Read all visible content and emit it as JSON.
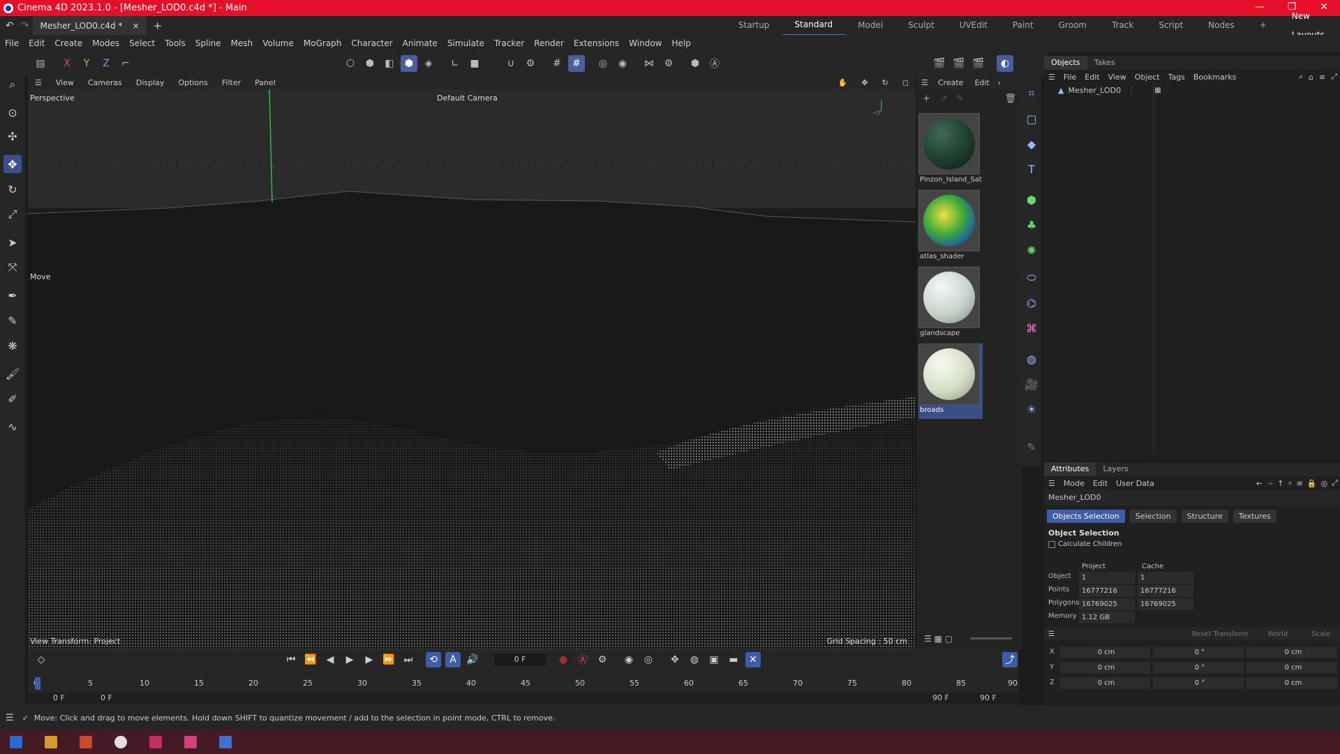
{
  "window": {
    "title": "Cinema 4D 2023.1.0 - [Mesher_LOD0.c4d *] - Main"
  },
  "doc_tab": {
    "label": "Mesher_LOD0.c4d *"
  },
  "layouts": [
    "Startup",
    "Standard",
    "Model",
    "Sculpt",
    "UVEdit",
    "Paint",
    "Groom",
    "Track",
    "Script",
    "Nodes"
  ],
  "layouts_active": "Standard",
  "new_layouts": "New Layouts",
  "menu": [
    "File",
    "Edit",
    "Create",
    "Modes",
    "Select",
    "Tools",
    "Spline",
    "Mesh",
    "Volume",
    "MoGraph",
    "Character",
    "Animate",
    "Simulate",
    "Tracker",
    "Render",
    "Extensions",
    "Window",
    "Help"
  ],
  "coord_buttons": {
    "x": "X",
    "y": "Y",
    "z": "Z"
  },
  "viewport": {
    "menu": [
      "View",
      "Cameras",
      "Display",
      "Options",
      "Filter",
      "Panel"
    ],
    "projection": "Perspective",
    "camera": "Default Camera",
    "move_hint": "Move",
    "view_transform": "View Transform: Project",
    "grid_spacing": "Grid Spacing : 50 cm"
  },
  "materials_panel": {
    "menu": [
      "Create",
      "Edit"
    ],
    "items": [
      {
        "name": "Pinzon_Island_Sat",
        "color": "#1f3d2c"
      },
      {
        "name": "atlas_shader",
        "color": "#3aa83a"
      },
      {
        "name": "glandscape",
        "color": "#c8d2cc"
      },
      {
        "name": "broads",
        "color": "#d6dcc6"
      }
    ]
  },
  "objects_panel": {
    "tabs": [
      "Objects",
      "Takes"
    ],
    "menu": [
      "File",
      "Edit",
      "View",
      "Object",
      "Tags",
      "Bookmarks"
    ],
    "items": [
      {
        "name": "Mesher_LOD0"
      }
    ]
  },
  "attributes_panel": {
    "tabs": [
      "Attributes",
      "Layers"
    ],
    "menu": [
      "Mode",
      "Edit",
      "User Data"
    ],
    "object_name": "Mesher_LOD0",
    "subtabs": [
      "Objects Selection",
      "Selection",
      "Structure",
      "Textures"
    ],
    "section": "Object Selection",
    "calculate_children": "Calculate Children",
    "calculate_children_checked": false,
    "columns": [
      "Project",
      "Cache"
    ],
    "rows": [
      {
        "label": "Object",
        "project": "1",
        "cache": "1"
      },
      {
        "label": "Points",
        "project": "16777216",
        "cache": "16777216"
      },
      {
        "label": "Polygons",
        "project": "16769025",
        "cache": "16769025"
      },
      {
        "label": "Memory",
        "project": "1.12 GB",
        "cache": ""
      }
    ],
    "transform": {
      "reset": "Reset Transform",
      "space": "World",
      "mode": "Scale",
      "axes": [
        {
          "axis": "X",
          "pos": "0 cm",
          "rot": "0 °",
          "scale": "0 cm"
        },
        {
          "axis": "Y",
          "pos": "0 cm",
          "rot": "0 °",
          "scale": "0 cm"
        },
        {
          "axis": "Z",
          "pos": "0 cm",
          "rot": "0 °",
          "scale": "0 cm"
        }
      ]
    }
  },
  "timeline": {
    "current_frame": "0 F",
    "ruler_ticks": [
      "0",
      "5",
      "10",
      "15",
      "20",
      "25",
      "30",
      "35",
      "40",
      "45",
      "50",
      "55",
      "60",
      "65",
      "70",
      "75",
      "80",
      "85",
      "90"
    ],
    "start": "0 F",
    "start2": "0 F",
    "end": "90 F",
    "end2": "90 F"
  },
  "status": {
    "message": "Move: Click and drag to move elements. Hold down SHIFT to quantize movement / add to the selection in point mode, CTRL to remove."
  }
}
